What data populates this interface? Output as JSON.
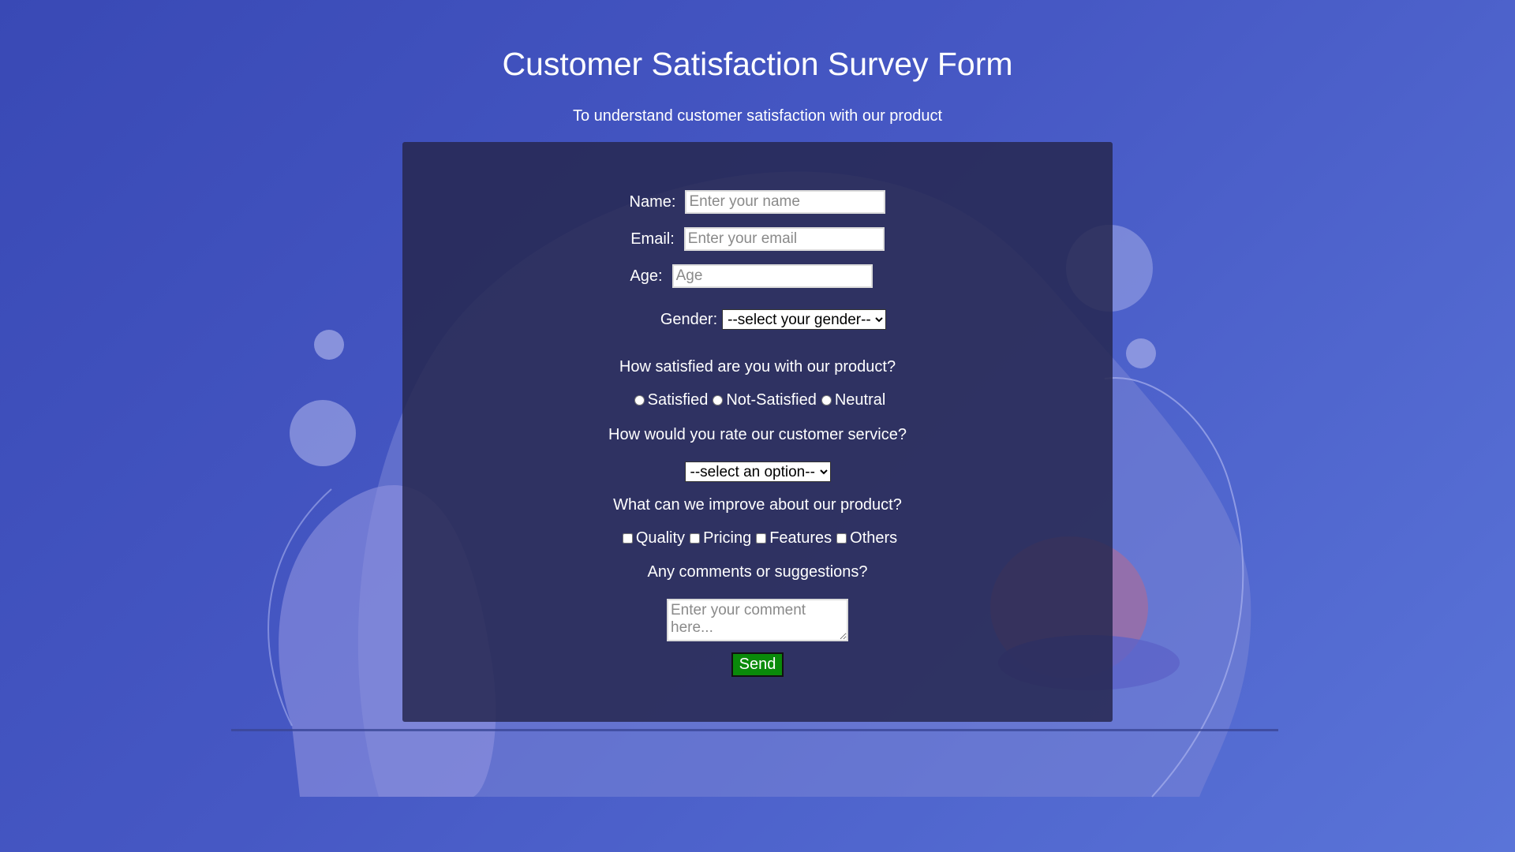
{
  "page": {
    "title": "Customer Satisfaction Survey Form",
    "subtitle": "To understand customer satisfaction with our product"
  },
  "form": {
    "name": {
      "label": "Name:",
      "placeholder": "Enter your name",
      "value": ""
    },
    "email": {
      "label": "Email:",
      "placeholder": "Enter your email",
      "value": ""
    },
    "age": {
      "label": "Age:",
      "placeholder": "Age",
      "value": ""
    },
    "gender": {
      "label": "Gender:",
      "selected": "--select your gender--"
    },
    "satisfaction": {
      "question": "How satisfied are you with our product?",
      "options": [
        "Satisfied",
        "Not-Satisfied",
        "Neutral"
      ]
    },
    "service": {
      "question": "How would you rate our customer service?",
      "selected": "--select an option--"
    },
    "improve": {
      "question": "What can we improve about our product?",
      "options": [
        "Quality",
        "Pricing",
        "Features",
        "Others"
      ]
    },
    "comments": {
      "question": "Any comments or suggestions?",
      "placeholder": "Enter your comment here..."
    },
    "send_label": "Send"
  },
  "colors": {
    "background_start": "#3949b5",
    "background_end": "#5a74d8",
    "panel": "#262850",
    "send_button": "#0a8a0a"
  }
}
